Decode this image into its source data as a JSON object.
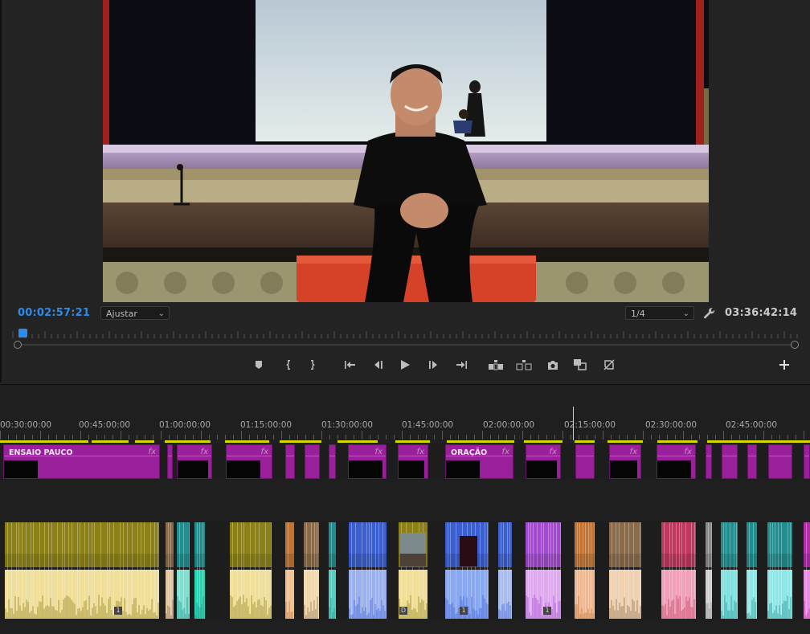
{
  "monitor": {
    "timecode": "00:02:57:21",
    "fit_select": "Ajustar",
    "resolution_select": "1/4",
    "duration": "03:36:42:14",
    "transport": [
      {
        "name": "add-marker-button",
        "icon": "marker-icon"
      },
      {
        "name": "mark-in-button",
        "icon": "mark-in-icon"
      },
      {
        "name": "mark-out-button",
        "icon": "mark-out-icon"
      },
      {
        "name": "go-to-in-button",
        "icon": "go-to-in-icon"
      },
      {
        "name": "step-back-button",
        "icon": "step-back-icon"
      },
      {
        "name": "play-button",
        "icon": "play-icon"
      },
      {
        "name": "step-forward-button",
        "icon": "step-forward-icon"
      },
      {
        "name": "go-to-out-button",
        "icon": "go-to-out-icon"
      },
      {
        "name": "lift-button",
        "icon": "lift-icon"
      },
      {
        "name": "extract-button",
        "icon": "extract-icon"
      },
      {
        "name": "export-frame-button",
        "icon": "camera-icon"
      },
      {
        "name": "comparison-view-button",
        "icon": "comparison-icon"
      },
      {
        "name": "proxy-toggle-button",
        "icon": "proxy-icon"
      },
      {
        "name": "button-editor-button",
        "icon": "plus-icon"
      }
    ]
  },
  "timeline": {
    "ruler_labels": [
      "00:30:00:00",
      "00:45:00:00",
      "01:00:00:00",
      "01:15:00:00",
      "01:30:00:00",
      "01:45:00:00",
      "02:00:00:00",
      "02:15:00:00",
      "02:30:00:00",
      "02:45:00:00"
    ],
    "clip_names": {
      "ensaio": "ENSAIO PAUCO",
      "oracao": "ORAÇÃO"
    },
    "fx_label": "fx",
    "badge_one": "1",
    "badge_d": "D"
  },
  "colors": {
    "accent_blue": "#2d8ceb",
    "video_clip": "#9a1f9a",
    "render_bar": "#d6d600",
    "audio_olive": "#8c8119",
    "audio_pale": "#f0df9a",
    "audio_blue": "#3b5fd0",
    "audio_violet": "#a44ad0",
    "audio_orange": "#c27430",
    "audio_pink": "#c0385e",
    "audio_teal": "#1f8f8f"
  }
}
